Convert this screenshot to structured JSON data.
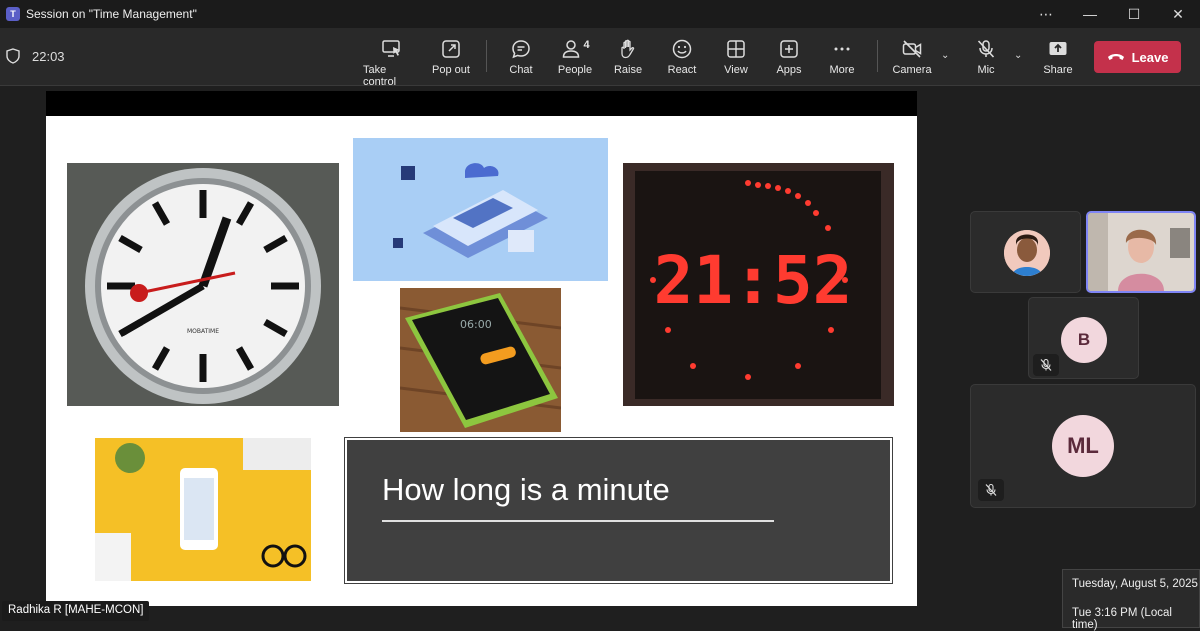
{
  "window": {
    "title": "Session on \"Time Management\"",
    "app_icon_letter": "T",
    "controls": [
      "⋯",
      "—",
      "☐",
      "✕"
    ]
  },
  "meeting": {
    "elapsed": "22:03"
  },
  "toolbar": {
    "take_control": "Take control",
    "pop_out": "Pop out",
    "chat": "Chat",
    "people": "People",
    "people_count": "4",
    "raise": "Raise",
    "react": "React",
    "view": "View",
    "apps": "Apps",
    "more": "More",
    "camera": "Camera",
    "mic": "Mic",
    "share": "Share",
    "leave": "Leave"
  },
  "slide": {
    "caption": "How long is a minute"
  },
  "presenter": {
    "name": "Radhika R [MAHE-MCON]"
  },
  "participants": [
    {
      "initials": "",
      "kind": "photo-avatar"
    },
    {
      "initials": "",
      "kind": "video"
    },
    {
      "initials": "B",
      "kind": "initials",
      "muted": true
    },
    {
      "initials": "ML",
      "kind": "initials",
      "muted": true
    }
  ],
  "datetime": {
    "date": "Tuesday, August 5, 2025",
    "time": "Tue 3:16 PM (Local time)"
  },
  "colors": {
    "leave": "#c4314b",
    "accent": "#7f85f5",
    "avatar_bg": "#f2d7dd"
  }
}
